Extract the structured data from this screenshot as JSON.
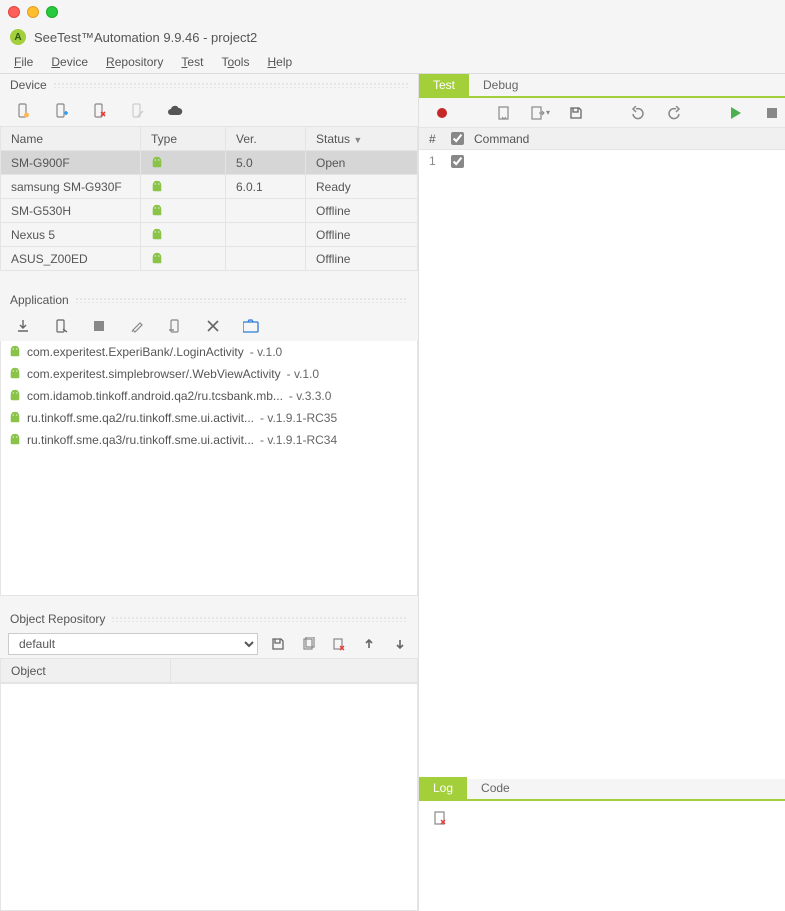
{
  "window": {
    "title": "SeeTest™Automation 9.9.46 - project2"
  },
  "menu": {
    "file": "File",
    "device": "Device",
    "repository": "Repository",
    "test": "Test",
    "tools": "Tools",
    "help": "Help"
  },
  "panels": {
    "device": "Device",
    "application": "Application",
    "objrepo": "Object Repository"
  },
  "deviceTable": {
    "headers": {
      "name": "Name",
      "type": "Type",
      "ver": "Ver.",
      "status": "Status"
    },
    "rows": [
      {
        "name": "SM-G900F",
        "ver": "5.0",
        "status": "Open",
        "selected": true
      },
      {
        "name": "samsung SM-G930F",
        "ver": "6.0.1",
        "status": "Ready",
        "selected": false
      },
      {
        "name": "SM-G530H",
        "ver": "",
        "status": "Offline",
        "selected": false
      },
      {
        "name": "Nexus 5",
        "ver": "",
        "status": "Offline",
        "selected": false
      },
      {
        "name": "ASUS_Z00ED",
        "ver": "",
        "status": "Offline",
        "selected": false
      }
    ]
  },
  "apps": [
    {
      "name": "com.experitest.ExperiBank/.LoginActivity",
      "ver": " - v.1.0"
    },
    {
      "name": "com.experitest.simplebrowser/.WebViewActivity",
      "ver": " - v.1.0"
    },
    {
      "name": "com.idamob.tinkoff.android.qa2/ru.tcsbank.mb...",
      "ver": " - v.3.3.0"
    },
    {
      "name": "ru.tinkoff.sme.qa2/ru.tinkoff.sme.ui.activit...",
      "ver": " - v.1.9.1-RC35"
    },
    {
      "name": "ru.tinkoff.sme.qa3/ru.tinkoff.sme.ui.activit...",
      "ver": " - v.1.9.1-RC34"
    }
  ],
  "objrepo": {
    "selected": "default",
    "objectHeader": "Object"
  },
  "rightTabs": {
    "test": "Test",
    "debug": "Debug"
  },
  "cmdHeader": {
    "num": "#",
    "command": "Command"
  },
  "cmdRows": [
    {
      "num": "1"
    }
  ],
  "logTabs": {
    "log": "Log",
    "code": "Code"
  }
}
